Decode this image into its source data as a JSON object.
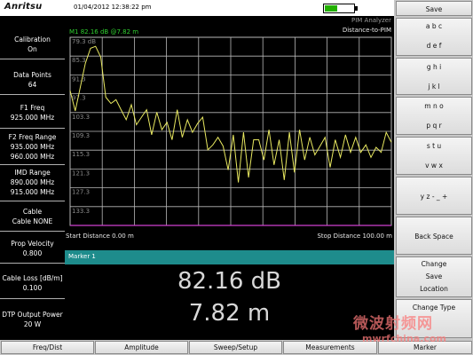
{
  "brand": "Anritsu",
  "datetime": "01/04/2012 12:38:22 pm",
  "battery_level": 0.45,
  "colors": {
    "trace": "#e8e860",
    "grid": "#b8b8b8",
    "marker_header": "#1e8c8c",
    "baseline": "#d040d0",
    "marker_text": "#30d030",
    "battery": "#22b000"
  },
  "mode": {
    "title": "PIM Analyzer",
    "subtitle": "Distance-to-PIM"
  },
  "left_panel": [
    {
      "label": "Calibration",
      "value": "On"
    },
    {
      "label": "Data Points",
      "value": "64"
    },
    {
      "label": "F1 Freq",
      "value": "925.000 MHz"
    },
    {
      "label": "F2 Freq Range",
      "value": "935.000 MHz",
      "value2": "960.000 MHz"
    },
    {
      "label": "IMD Range",
      "value": "890.000 MHz",
      "value2": "915.000 MHz"
    },
    {
      "label": "Cable",
      "value": "Cable NONE"
    },
    {
      "label": "Prop Velocity",
      "value": "0.800"
    },
    {
      "label": "Cable Loss [dB/m]",
      "value": "0.100"
    },
    {
      "label": "DTP Output Power",
      "value": "20 W"
    }
  ],
  "plot": {
    "marker_label": "M1  82.16 dB @7.82 m",
    "start_label": "Start Distance 0.00 m",
    "stop_label": "Stop Distance 100.00 m",
    "y_ticks": [
      "79.3 dB",
      "85.3",
      "91.3",
      "97.3",
      "103.3",
      "109.3",
      "115.3",
      "121.3",
      "127.3",
      "133.3"
    ]
  },
  "chart_data": {
    "type": "line",
    "x_range": [
      0,
      100
    ],
    "y_range": [
      79.3,
      139.3
    ],
    "y_inverted": true,
    "grid": true,
    "y_ticks": [
      79.3,
      85.3,
      91.3,
      97.3,
      103.3,
      109.3,
      115.3,
      121.3,
      127.3,
      133.3
    ],
    "series": [
      {
        "x": [
          0,
          1.59,
          3.17,
          4.76,
          6.35,
          7.94,
          9.52,
          11.11,
          12.7,
          14.29,
          15.87,
          17.46,
          19.05,
          20.63,
          22.22,
          23.81,
          25.4,
          26.98,
          28.57,
          30.16,
          31.75,
          33.33,
          34.92,
          36.51,
          38.1,
          39.68,
          41.27,
          42.86,
          44.44,
          46.03,
          47.62,
          49.21,
          50.79,
          52.38,
          53.97,
          55.56,
          57.14,
          58.73,
          60.32,
          61.9,
          63.49,
          65.08,
          66.67,
          68.25,
          69.84,
          71.43,
          73.02,
          74.6,
          76.19,
          77.78,
          79.37,
          80.95,
          82.54,
          84.13,
          85.71,
          87.3,
          88.89,
          90.48,
          92.06,
          93.65,
          95.24,
          96.83,
          98.41,
          100
        ],
        "y": [
          96.3,
          102.8,
          95.2,
          87.6,
          82.8,
          82.2,
          85.6,
          98.4,
          100.4,
          99.2,
          102.4,
          105.6,
          100.8,
          107.2,
          104.8,
          102.4,
          110.4,
          103.2,
          108.8,
          106.4,
          112.0,
          102.4,
          111.2,
          105.6,
          109.6,
          106.8,
          104.8,
          115.2,
          113.6,
          111.2,
          114.0,
          121.6,
          110.4,
          125.6,
          109.6,
          124.0,
          112.0,
          112.0,
          118.4,
          108.8,
          120.0,
          112.0,
          124.8,
          109.6,
          122.4,
          108.8,
          118.4,
          111.2,
          116.8,
          114.0,
          111.2,
          120.8,
          112.0,
          117.6,
          110.4,
          116.0,
          111.2,
          116.0,
          113.6,
          117.6,
          114.4,
          116.0,
          109.6,
          112.8
        ]
      }
    ]
  },
  "marker_table": {
    "header": "Marker 1",
    "value1": "82.16 dB",
    "value2": "7.82 m"
  },
  "soft_keys": [
    {
      "lines": [
        "Save"
      ]
    },
    {
      "lines": [
        "a b c",
        "d e f"
      ]
    },
    {
      "lines": [
        "g h i",
        "j k l"
      ]
    },
    {
      "lines": [
        "m n o",
        "p q r"
      ]
    },
    {
      "lines": [
        "s t u",
        "v w x"
      ]
    },
    {
      "lines": [
        "y z - _ +"
      ]
    },
    {
      "lines": [
        "Back Space"
      ]
    },
    {
      "lines": [
        "Change",
        "Save",
        "Location"
      ]
    },
    {
      "lines": [
        "Change Type"
      ]
    }
  ],
  "bottom_menu": [
    "Freq/Dist",
    "Amplitude",
    "Sweep/Setup",
    "Measurements",
    "Marker"
  ],
  "watermark": {
    "cn": "微波射频网",
    "url": "mwrfchina.com"
  }
}
